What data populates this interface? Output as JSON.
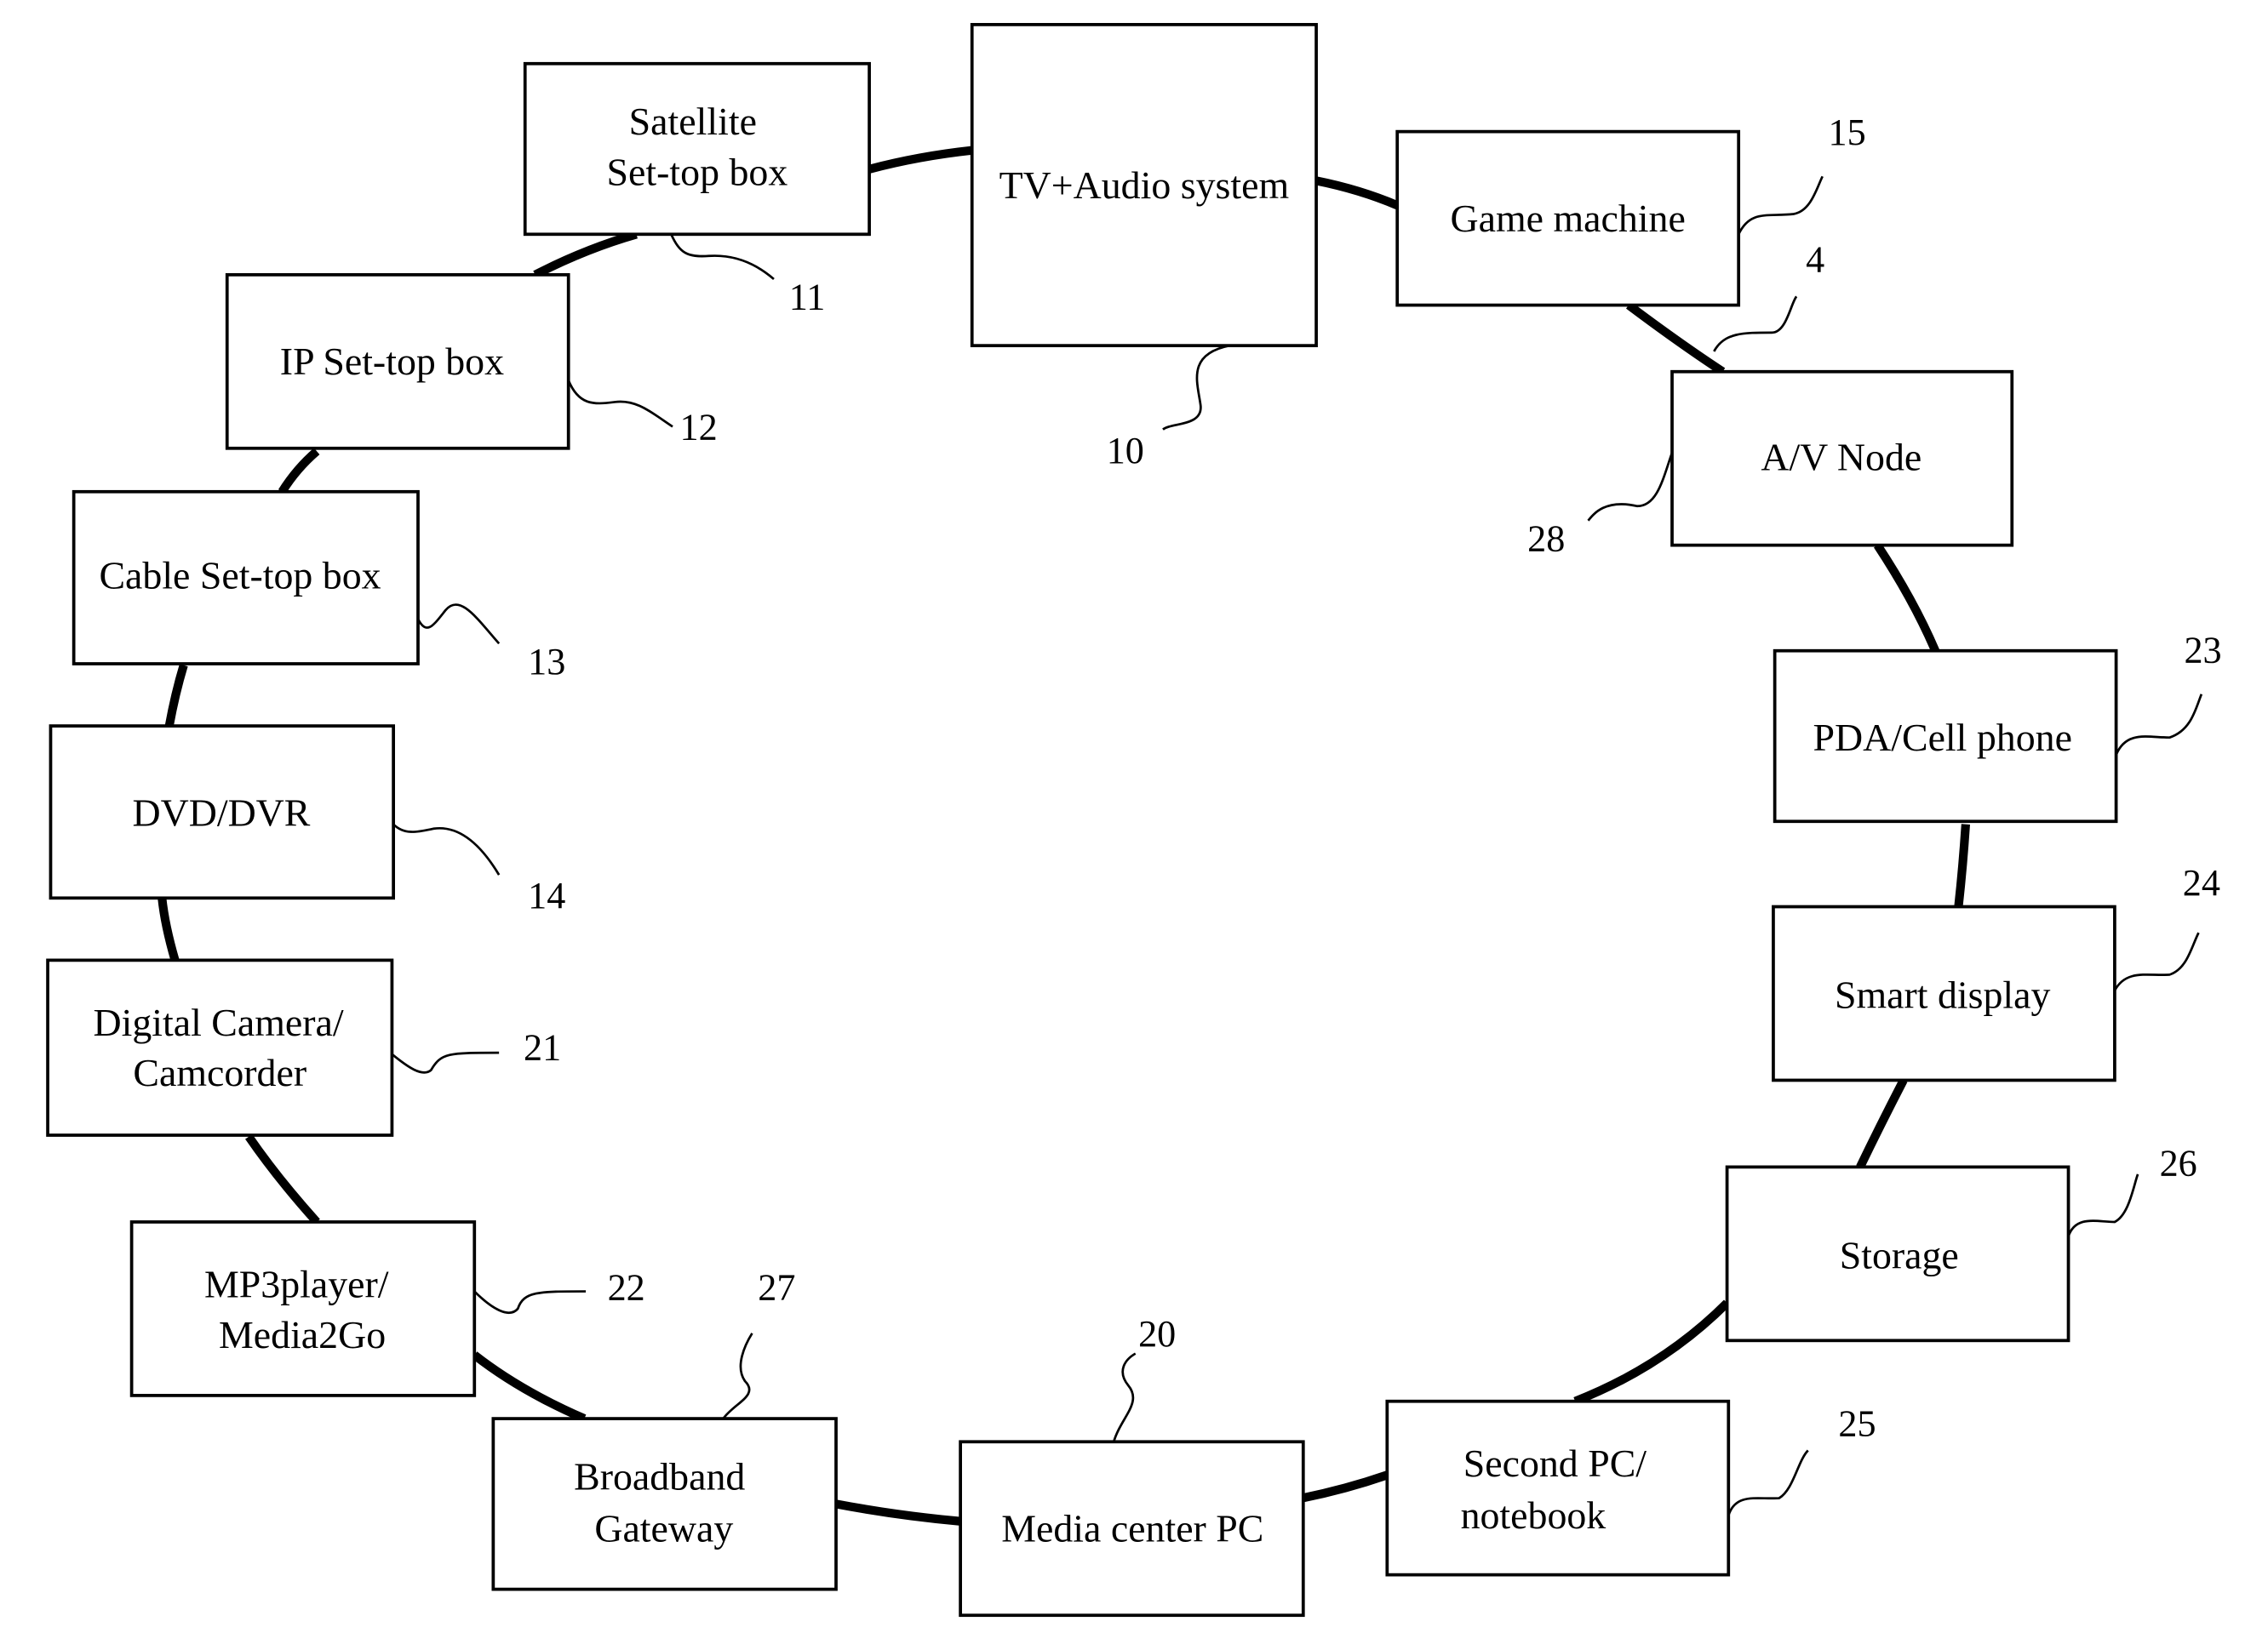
{
  "diagram": {
    "type": "ring-network",
    "nodes": [
      {
        "id": "tv",
        "lines": [
          "TV+Audio system"
        ],
        "ref": "10"
      },
      {
        "id": "game",
        "lines": [
          "Game machine"
        ],
        "ref": "15"
      },
      {
        "id": "av-node",
        "lines": [
          "A/V Node"
        ],
        "ref": "28"
      },
      {
        "id": "pda",
        "lines": [
          "PDA/Cell phone"
        ],
        "ref": "23"
      },
      {
        "id": "smart-display",
        "lines": [
          "Smart display"
        ],
        "ref": "24"
      },
      {
        "id": "storage",
        "lines": [
          "Storage"
        ],
        "ref": "26"
      },
      {
        "id": "second-pc",
        "lines": [
          "Second PC/",
          "notebook"
        ],
        "ref": "25"
      },
      {
        "id": "media-center",
        "lines": [
          "Media center PC"
        ],
        "ref": "20"
      },
      {
        "id": "broadband",
        "lines": [
          "Broadband",
          "Gateway"
        ],
        "ref": "27"
      },
      {
        "id": "mp3",
        "lines": [
          "MP3player/",
          "Media2Go"
        ],
        "ref": "22"
      },
      {
        "id": "camera",
        "lines": [
          "Digital Camera/",
          "Camcorder"
        ],
        "ref": "21"
      },
      {
        "id": "dvd",
        "lines": [
          "DVD/DVR"
        ],
        "ref": "14"
      },
      {
        "id": "cable",
        "lines": [
          "Cable Set-top box"
        ],
        "ref": "13"
      },
      {
        "id": "ip-stb",
        "lines": [
          "IP Set-top box"
        ],
        "ref": "12"
      },
      {
        "id": "satellite",
        "lines": [
          "Satellite",
          "Set-top box"
        ],
        "ref": "11"
      }
    ],
    "ring_ref": "4"
  }
}
